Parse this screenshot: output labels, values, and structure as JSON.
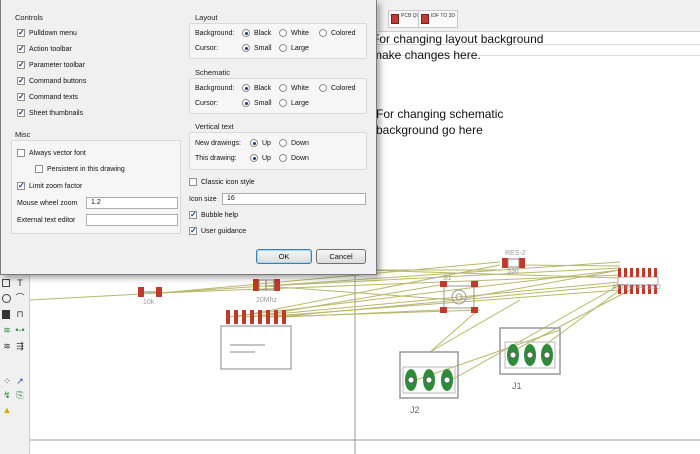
{
  "dialog": {
    "controls": {
      "title": "Controls",
      "items": [
        {
          "label": "Pulldown menu",
          "checked": true
        },
        {
          "label": "Action toolbar",
          "checked": true
        },
        {
          "label": "Parameter toolbar",
          "checked": true
        },
        {
          "label": "Command buttons",
          "checked": true
        },
        {
          "label": "Command texts",
          "checked": true
        },
        {
          "label": "Sheet thumbnails",
          "checked": true
        }
      ]
    },
    "misc": {
      "title": "Misc",
      "always_vector_font": "Always vector font",
      "persistent": "Persistent in this drawing",
      "limit_zoom": "Limit zoom factor",
      "mouse_wheel_zoom_label": "Mouse wheel zoom",
      "mouse_wheel_zoom_value": "1.2",
      "external_text_editor_label": "External text editor",
      "external_text_editor_value": ""
    },
    "layout": {
      "title": "Layout",
      "background_label": "Background:",
      "cursor_label": "Cursor:",
      "background_options": [
        "Black",
        "White",
        "Colored"
      ],
      "background_selected": "Black",
      "cursor_options": [
        "Small",
        "Large"
      ],
      "cursor_selected": "Small"
    },
    "schematic": {
      "title": "Schematic",
      "background_label": "Background:",
      "cursor_label": "Cursor:",
      "background_options": [
        "Black",
        "White",
        "Colored"
      ],
      "background_selected": "Black",
      "cursor_options": [
        "Small",
        "Large"
      ],
      "cursor_selected": "Small"
    },
    "vertical_text": {
      "title": "Vertical text",
      "new_drawings_label": "New drawings:",
      "this_drawing_label": "This drawing:",
      "options": [
        "Up",
        "Down"
      ],
      "new_selected": "Up",
      "this_selected": "Up"
    },
    "classic_icon_style": "Classic icon style",
    "icon_size_label": "Icon size",
    "icon_size_value": "16",
    "bubble_help": "Bubble help",
    "user_guidance": "User guidance",
    "ok_label": "OK",
    "cancel_label": "Cancel"
  },
  "annotations": {
    "layout_note": "For changing layout background make changes here.",
    "schematic_note": "For changing schematic background go here"
  },
  "toolbar": {
    "pcb_quote": "PCB QUOTE",
    "idf_to_3d": "IDF TO 3D"
  },
  "board": {
    "labels": [
      "RES-2",
      "330",
      "20Mhz",
      "10k",
      "S1",
      "ATTINY44-SSU",
      "J1",
      "J2"
    ]
  },
  "colors": {
    "dialog_bg": "#f0f0f0",
    "airwire": "#b8b86a",
    "pad_red": "#c0392b",
    "pad_green": "#2e8b3a"
  }
}
